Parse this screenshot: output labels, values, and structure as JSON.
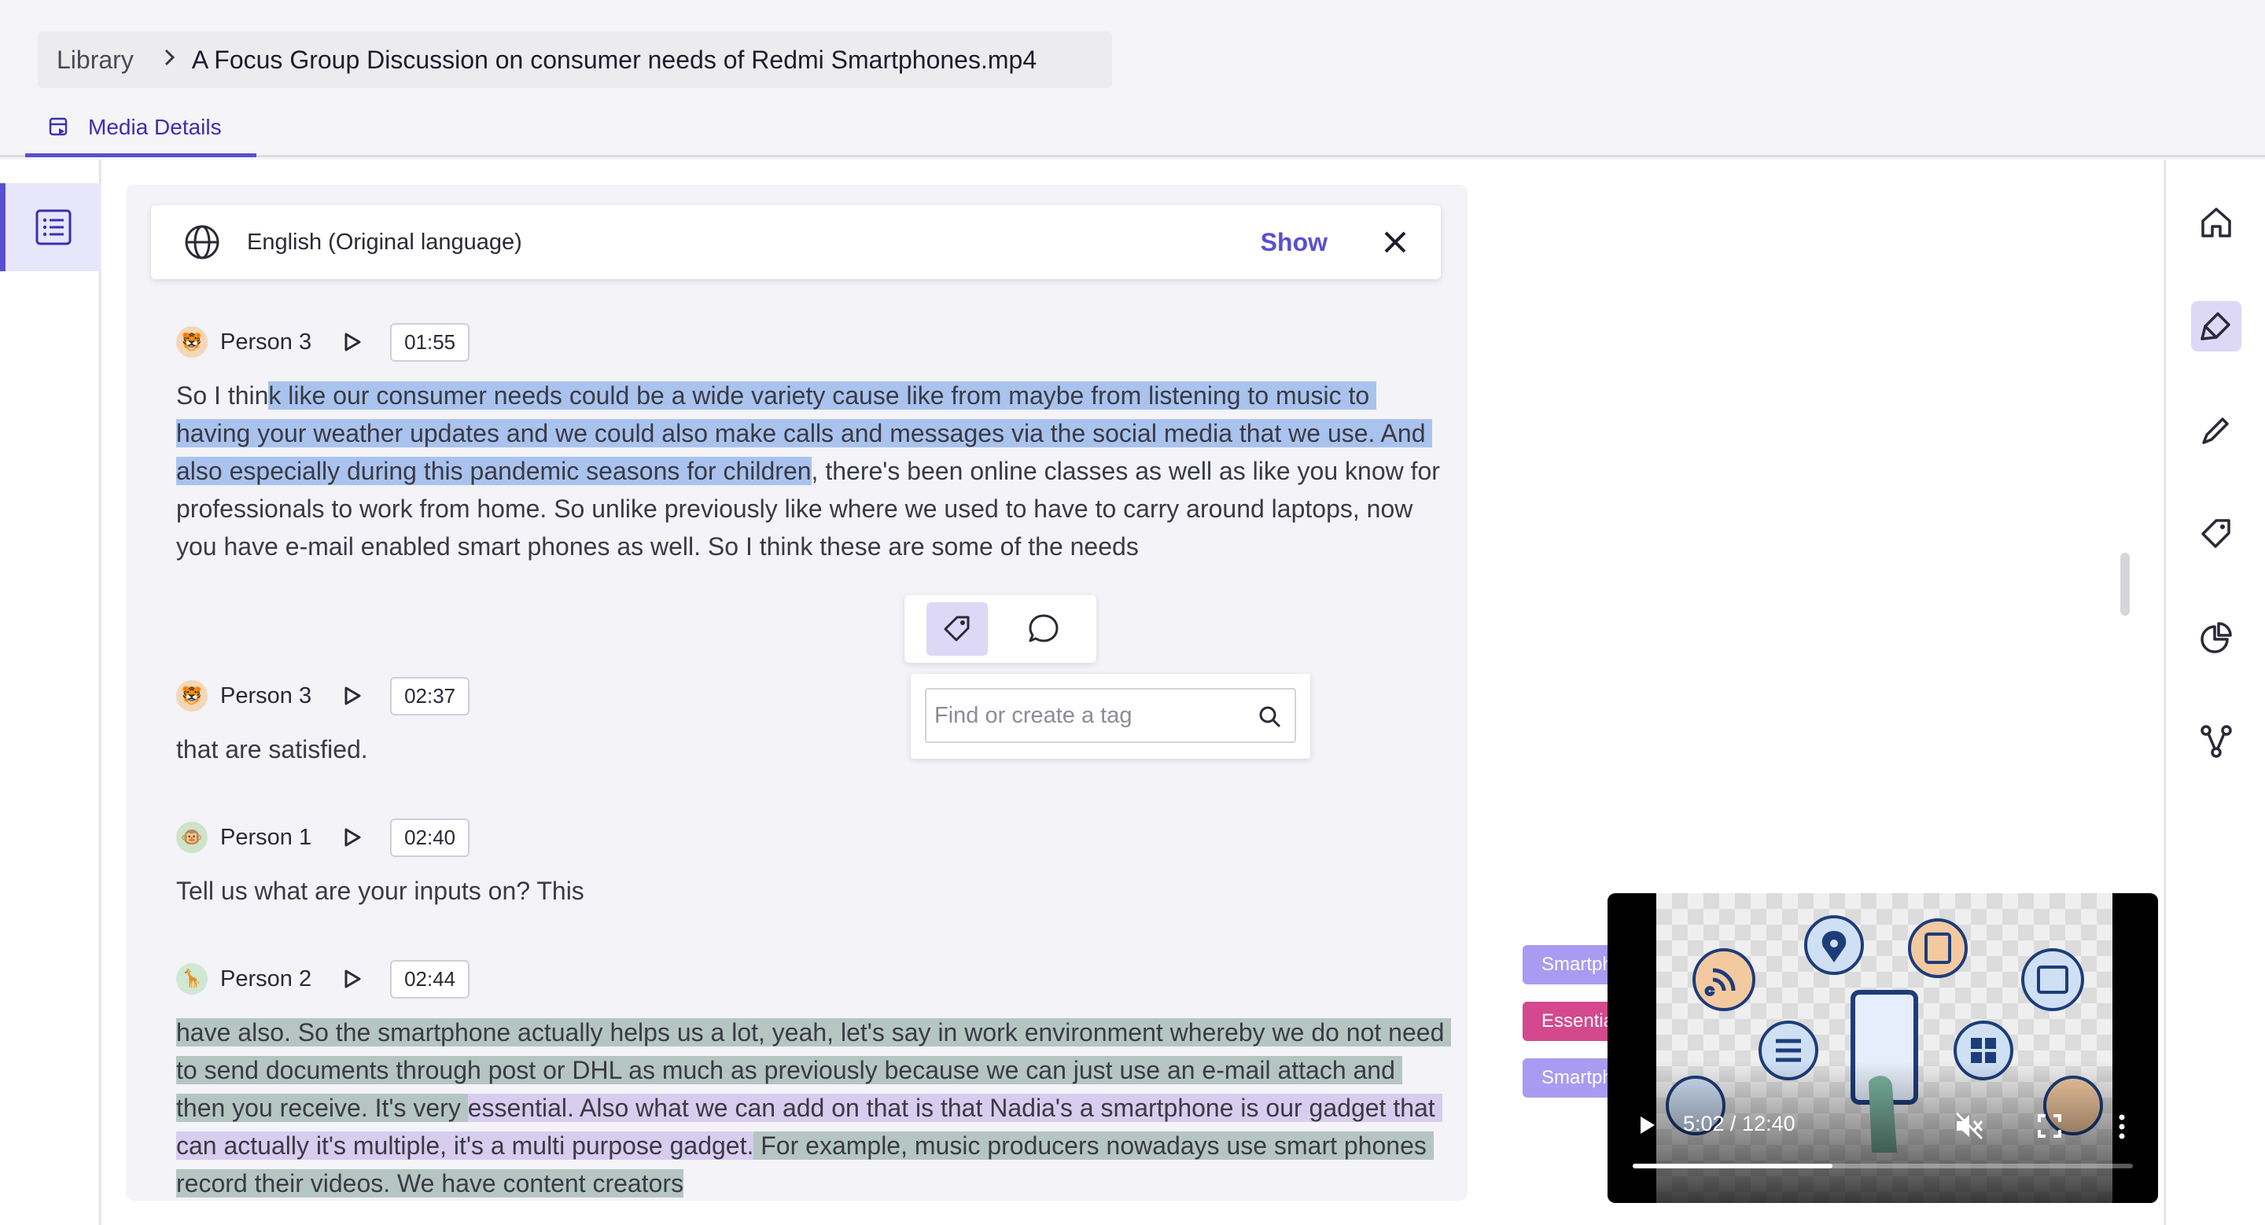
{
  "breadcrumb": {
    "library": "Library",
    "file": "A Focus Group Discussion on consumer needs of Redmi Smartphones.mp4"
  },
  "tabs": [
    {
      "label": "Media Details",
      "icon": "media-details-icon"
    }
  ],
  "language_bar": {
    "language": "English (Original language)",
    "show_label": "Show"
  },
  "segments": [
    {
      "speaker": "Person 3",
      "avatar": "tiger",
      "timestamp": "01:55",
      "text_parts": [
        {
          "text": "So I thin",
          "hl": ""
        },
        {
          "text": "k like our consumer needs could be a wide variety cause like from maybe from listening to music to having your weather updates and we coul",
          "hl": "blue"
        },
        {
          "text": "d also make calls and messages via the social media that we use. And also especially during this pandemic seasons for children",
          "hl": "blue"
        },
        {
          "text": ", there's been online classes as well as like you know for professionals to work from home. So unlike previously like where we used to have to carry around laptops, now you have e-mail enabled smart phones as well. So I think these are some of the needs",
          "hl": ""
        }
      ]
    },
    {
      "speaker": "Person 3",
      "avatar": "tiger",
      "timestamp": "02:37",
      "text_parts": [
        {
          "text": "that are satisfied.",
          "hl": ""
        }
      ]
    },
    {
      "speaker": "Person 1",
      "avatar": "monkey",
      "timestamp": "02:40",
      "text_parts": [
        {
          "text": "Tell us what are your inputs on? This",
          "hl": ""
        }
      ]
    },
    {
      "speaker": "Person 2",
      "avatar": "giraffe",
      "timestamp": "02:44",
      "text_parts": [
        {
          "text": "have also. So the smartphone actually helps us a lot, yeah, let's say in work environment whereby we do not need to send documents through post or DHL as much as previously because we can just use an e-mail attach and then you receive. It's very ",
          "hl": "green"
        },
        {
          "text": "essential. Also what we can add on that is that Nadia's a smartphone is our gadget that can actually it's multiple, it's a multi purpose gadget.",
          "hl": "purple"
        },
        {
          "text": " For example, music producers nowadays use smart phones record their videos. We have content creators",
          "hl": "green"
        }
      ]
    }
  ],
  "tag_popover": {
    "search_placeholder": "Find or create a tag",
    "actions": [
      "tag-icon",
      "comment-icon"
    ]
  },
  "tag_chips": [
    {
      "label": "Smartphone",
      "color": "#a99bf2"
    },
    {
      "label": "Essential",
      "color": "#d4498e"
    },
    {
      "label": "Smartphone",
      "color": "#a99bf2"
    }
  ],
  "video": {
    "time": "5:02 / 12:40",
    "progress": 0.4
  },
  "right_rail": [
    "home-icon",
    "highlight-icon",
    "pen-icon",
    "tag-icon",
    "chart-icon",
    "flow-icon"
  ],
  "colors": {
    "accent": "#5a4fcf",
    "highlight_blue": "#a9c3ee",
    "highlight_green": "#b5c6c2",
    "highlight_purple": "#d7cdee"
  }
}
